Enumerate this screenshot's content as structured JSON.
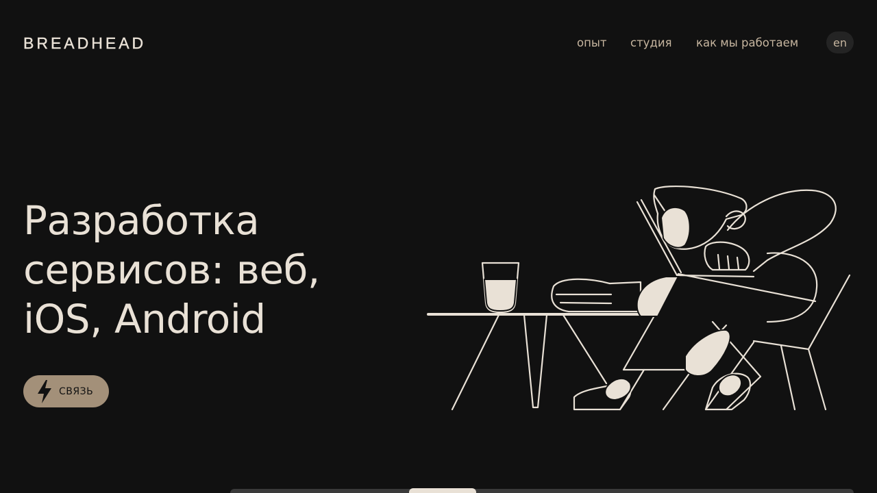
{
  "header": {
    "logo": "BREADHEAD",
    "nav": [
      "опыт",
      "студия",
      "как мы работаем"
    ],
    "lang": "en"
  },
  "hero": {
    "headline_lines": [
      "Разработка",
      "сервисов: веб,",
      "iOS, Android"
    ],
    "cta_label": "СВЯЗЬ",
    "cta_icon": "lightning-bolt-icon",
    "illustration": "person-sleeping-at-desk-illustration"
  },
  "colors": {
    "background": "#111111",
    "text": "#e9e1d6",
    "nav_text": "#c7b6a0",
    "accent": "#a39079",
    "lang_bg": "#242424"
  }
}
